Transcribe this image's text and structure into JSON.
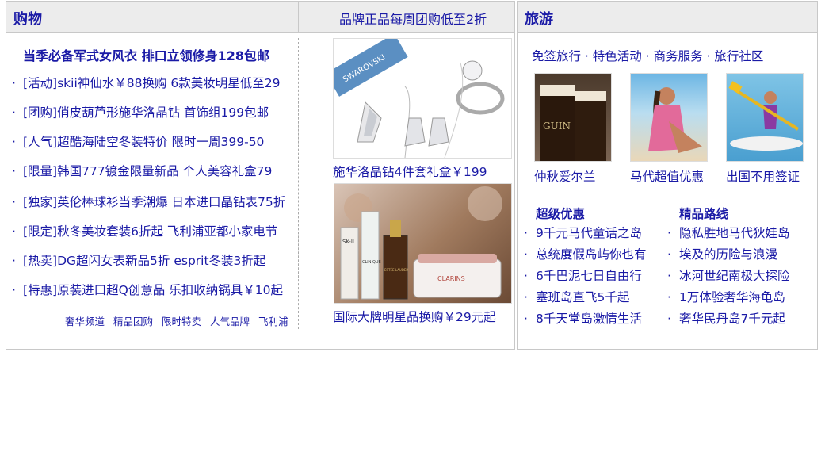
{
  "shopping": {
    "title": "购物",
    "slogan": "品牌正品每周团购低至2折",
    "headline": "当季必备军式女风衣 排口立领修身128包邮",
    "bullet": "·",
    "group1": [
      "[活动]skii神仙水￥88换购 6款美妆明星低至29",
      "[团购]俏皮葫芦形施华洛晶钻 首饰组199包邮",
      "[人气]超酷海陆空冬装特价 限时一周399-50",
      "[限量]韩国777镀金限量新品 个人美容礼盒79"
    ],
    "group2": [
      "[独家]英伦棒球衫当季潮爆 日本进口晶钻表75折",
      "[限定]秋冬美妆套装6折起 飞利浦亚都小家电节",
      "[热卖]DG超闪女表新品5折 esprit冬装3折起",
      "[特惠]原装进口超Q创意品 乐扣收纳锅具￥10起"
    ],
    "links": [
      "奢华频道",
      "精品团购",
      "限时特卖",
      "人气品牌",
      "飞利浦"
    ],
    "promo1": {
      "caption": "施华洛晶钻4件套礼盒￥199",
      "brand": "SWAROVSKI"
    },
    "promo2": {
      "caption": "国际大牌明星品换购￥29元起",
      "brands": [
        "SK-II",
        "CLINIQUE",
        "ESTÉE LAUDER",
        "CLARINS"
      ]
    }
  },
  "travel": {
    "title": "旅游",
    "subnav": "免签旅行 · 特色活动 · 商务服务 · 旅行社区",
    "thumbs": [
      {
        "caption": "仲秋爱尔兰",
        "label": "GUIN"
      },
      {
        "caption": "马代超值优惠"
      },
      {
        "caption": "出国不用签证"
      }
    ],
    "bullet": "·",
    "deals": {
      "title": "超级优惠",
      "items": [
        "9千元马代童话之岛",
        "总统度假岛屿你也有",
        "6千巴泥七日自由行",
        "塞班岛直飞5千起",
        "8千天堂岛激情生活"
      ]
    },
    "routes": {
      "title": "精品路线",
      "items": [
        "隐私胜地马代狄娃岛",
        "埃及的历险与浪漫",
        "冰河世纪南极大探险",
        "1万体验奢华海龟岛",
        "奢华民丹岛7千元起"
      ]
    }
  },
  "colors": {
    "link": "#1a1aa6",
    "header_bg": "#ececec",
    "border": "#c8c8c8"
  }
}
